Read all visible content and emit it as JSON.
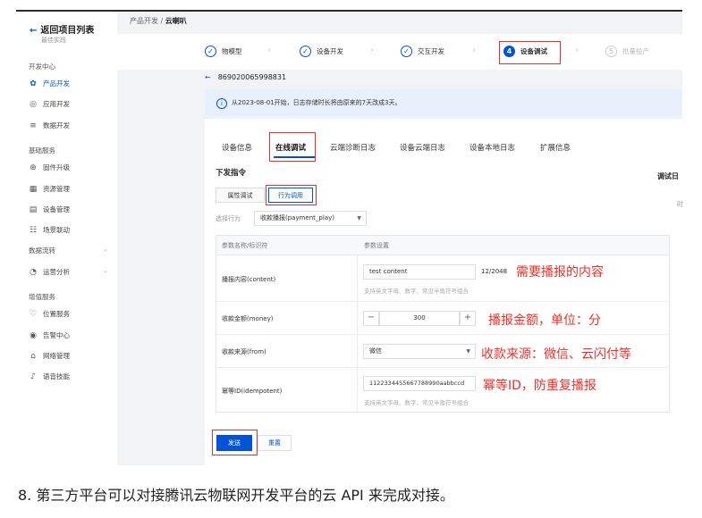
{
  "sidebar": {
    "back_label": "返回项目列表",
    "subtitle": "最佳实践",
    "groups": [
      {
        "title": "开发中心",
        "items": [
          {
            "label": "产品开发",
            "icon": "gear-icon",
            "active": true
          },
          {
            "label": "应用开发",
            "icon": "app-icon"
          },
          {
            "label": "数据开发",
            "icon": "data-icon"
          }
        ]
      },
      {
        "title": "基础服务",
        "items": [
          {
            "label": "固件升级",
            "icon": "upgrade-icon"
          },
          {
            "label": "资源管理",
            "icon": "resource-icon"
          },
          {
            "label": "设备管理",
            "icon": "device-icon"
          },
          {
            "label": "场景联动",
            "icon": "scene-icon"
          }
        ]
      },
      {
        "title": "数据流转",
        "items": [
          {
            "label": "运营分析",
            "icon": "analysis-icon"
          }
        ]
      },
      {
        "title": "增值服务",
        "items": [
          {
            "label": "位置服务",
            "icon": "location-icon"
          },
          {
            "label": "告警中心",
            "icon": "alarm-icon"
          },
          {
            "label": "网络管理",
            "icon": "network-icon"
          },
          {
            "label": "语音技能",
            "icon": "voice-icon"
          }
        ]
      }
    ]
  },
  "breadcrumb": {
    "parent": "产品开发",
    "separator": "/",
    "current": "云喇叭"
  },
  "steps": [
    {
      "label": "物模型",
      "status": "done",
      "mark": "✓"
    },
    {
      "label": "设备开发",
      "status": "done",
      "mark": "✓"
    },
    {
      "label": "交互开发",
      "status": "done",
      "mark": "✓"
    },
    {
      "label": "设备调试",
      "status": "current",
      "mark": "4"
    },
    {
      "label": "批量投产",
      "status": "todo",
      "mark": "5"
    }
  ],
  "device_id": "869020065998831",
  "notice": "从2023-08-01开始，日志存储时长将由原来的7天改成3天。",
  "tabs": [
    "设备信息",
    "在线调试",
    "云端诊断日志",
    "设备云端日志",
    "设备本地日志",
    "扩展信息"
  ],
  "section_title": "下发指令",
  "right_section_title": "调试日",
  "right_fragment": "时",
  "sub_tabs": [
    "属性调试",
    "行为调用"
  ],
  "select_label": "选择行为",
  "select_value": "收款播报(payment_play)",
  "table": {
    "col1": "参数名称/标识符",
    "col2": "参数设置",
    "rows": [
      {
        "label": "播报内容(content)",
        "value": "test content",
        "count": "12/2048",
        "hint": "支持英文字母、数字、常见半角符号组合"
      },
      {
        "label": "收款金额(money)",
        "value": "300",
        "minus": "−",
        "plus": "+"
      },
      {
        "label": "收款来源(from)",
        "value": "微信"
      },
      {
        "label": "幂等ID(idempotent)",
        "value": "1122334455667788990aabbccd",
        "hint": "支持英文字母、数字、常见半角符号组合"
      }
    ]
  },
  "annotations": [
    "需要播报的内容",
    "播报金额，单位：分",
    "收款来源：微信、云闪付等",
    "幂等ID，防重复播报"
  ],
  "buttons": {
    "send": "发送",
    "reset": "重置"
  },
  "caption": "8. 第三方平台可以对接腾讯云物联网开发平台的云 API 来完成对接。",
  "colors": {
    "primary": "#0052d9",
    "annotation": "#e8302a",
    "notice_bg": "#e8f0fd"
  }
}
